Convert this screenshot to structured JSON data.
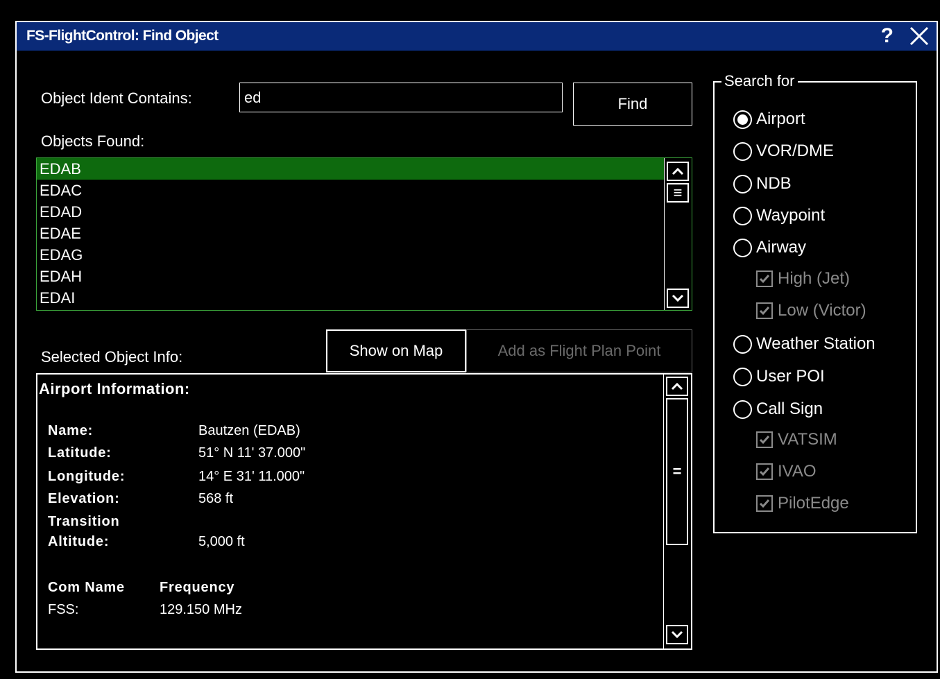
{
  "window": {
    "title": "FS-FlightControl: Find Object",
    "help": "?"
  },
  "search": {
    "label": "Object Ident Contains:",
    "value": "ed",
    "find_label": "Find"
  },
  "results": {
    "label": "Objects Found:",
    "items": [
      "EDAB",
      "EDAC",
      "EDAD",
      "EDAE",
      "EDAG",
      "EDAH",
      "EDAI"
    ],
    "selected_index": 0
  },
  "selected": {
    "label": "Selected Object Info:",
    "show_on_map": "Show on Map",
    "add_flight_plan": "Add as Flight Plan Point"
  },
  "info": {
    "heading": "Airport Information:",
    "name_label": "Name:",
    "name_value": "Bautzen (EDAB)",
    "lat_label": "Latitude:",
    "lat_value": "51° N 11' 37.000\"",
    "lon_label": "Longitude:",
    "lon_value": "14° E 31' 11.000\"",
    "elev_label": "Elevation:",
    "elev_value": "568 ft",
    "trans_label_1": "Transition",
    "trans_label_2": "Altitude:",
    "trans_value": "5,000 ft",
    "com_name_header": "Com Name",
    "frequency_header": "Frequency",
    "com_name": "FSS:",
    "com_freq": "129.150 MHz"
  },
  "search_for": {
    "legend": "Search for",
    "airport": "Airport",
    "vor": "VOR/DME",
    "ndb": "NDB",
    "waypoint": "Waypoint",
    "airway": "Airway",
    "high": "High (Jet)",
    "low": "Low (Victor)",
    "weather": "Weather Station",
    "user_poi": "User POI",
    "call_sign": "Call Sign",
    "vatsim": "VATSIM",
    "ivao": "IVAO",
    "pilotedge": "PilotEdge",
    "selected": "Airport"
  },
  "colors": {
    "titlebar": "#0a2a78",
    "selection": "#0e6a0e",
    "list_border": "#3ba33b",
    "disabled": "#8a8a8a"
  }
}
